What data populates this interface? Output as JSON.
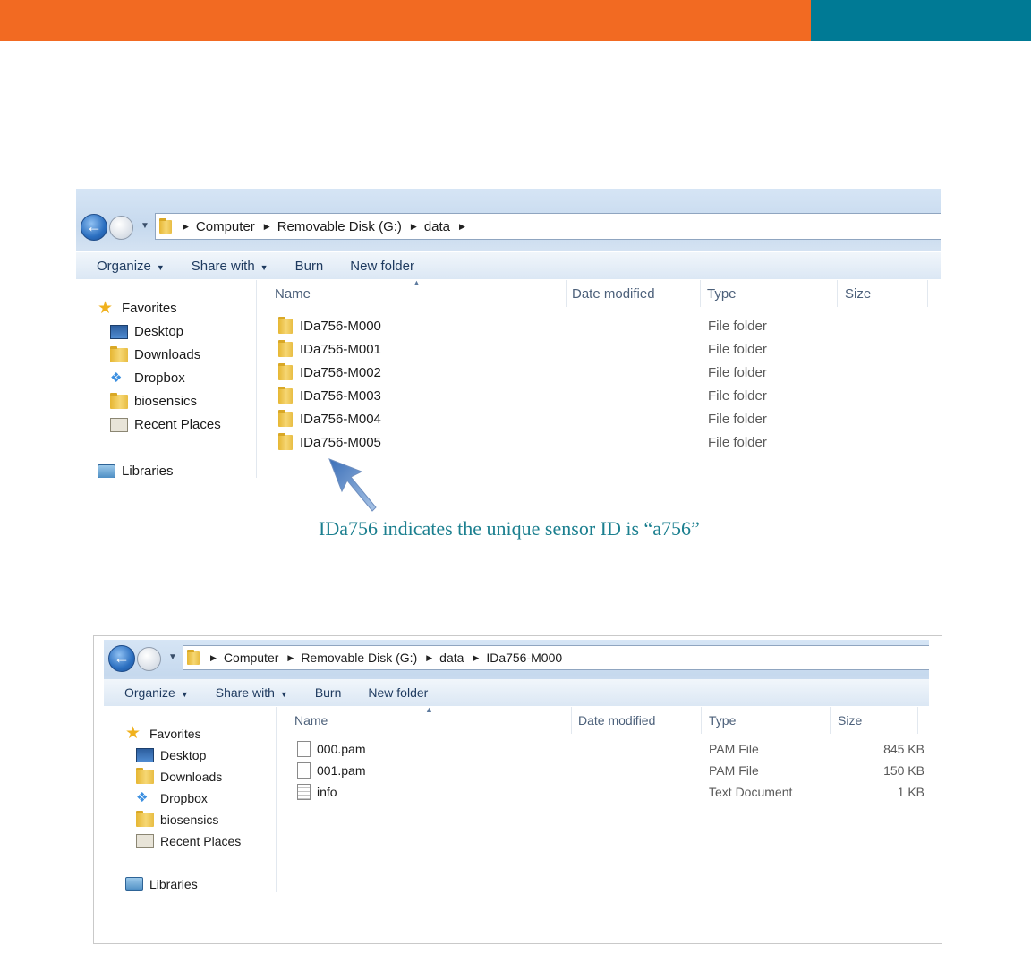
{
  "colors": {
    "orange_band": "#f26a22",
    "teal_band": "#007a95",
    "caption": "#1b7f8f"
  },
  "explorer1": {
    "breadcrumb": [
      "Computer",
      "Removable Disk (G:)",
      "data"
    ],
    "toolbar": {
      "organize": "Organize",
      "share_with": "Share with",
      "burn": "Burn",
      "new_folder": "New folder"
    },
    "nav": {
      "favorites": "Favorites",
      "desktop": "Desktop",
      "downloads": "Downloads",
      "dropbox": "Dropbox",
      "biosensics": "biosensics",
      "recent_places": "Recent Places",
      "libraries": "Libraries"
    },
    "columns": {
      "name": "Name",
      "date": "Date modified",
      "type": "Type",
      "size": "Size"
    },
    "rows": [
      {
        "name": "IDa756-M000",
        "type": "File folder",
        "size": ""
      },
      {
        "name": "IDa756-M001",
        "type": "File folder",
        "size": ""
      },
      {
        "name": "IDa756-M002",
        "type": "File folder",
        "size": ""
      },
      {
        "name": "IDa756-M003",
        "type": "File folder",
        "size": ""
      },
      {
        "name": "IDa756-M004",
        "type": "File folder",
        "size": ""
      },
      {
        "name": "IDa756-M005",
        "type": "File folder",
        "size": ""
      }
    ]
  },
  "annotation": {
    "text": "IDa756 indicates the unique sensor ID is “a756”"
  },
  "explorer2": {
    "breadcrumb": [
      "Computer",
      "Removable Disk (G:)",
      "data",
      "IDa756-M000"
    ],
    "toolbar": {
      "organize": "Organize",
      "share_with": "Share with",
      "burn": "Burn",
      "new_folder": "New folder"
    },
    "nav": {
      "favorites": "Favorites",
      "desktop": "Desktop",
      "downloads": "Downloads",
      "dropbox": "Dropbox",
      "biosensics": "biosensics",
      "recent_places": "Recent Places",
      "libraries": "Libraries"
    },
    "columns": {
      "name": "Name",
      "date": "Date modified",
      "type": "Type",
      "size": "Size"
    },
    "rows": [
      {
        "name": "000.pam",
        "type": "PAM File",
        "size": "845 KB",
        "icon": "file-icon"
      },
      {
        "name": "001.pam",
        "type": "PAM File",
        "size": "150 KB",
        "icon": "file-icon"
      },
      {
        "name": "info",
        "type": "Text Document",
        "size": "1 KB",
        "icon": "text-document-icon"
      }
    ]
  }
}
